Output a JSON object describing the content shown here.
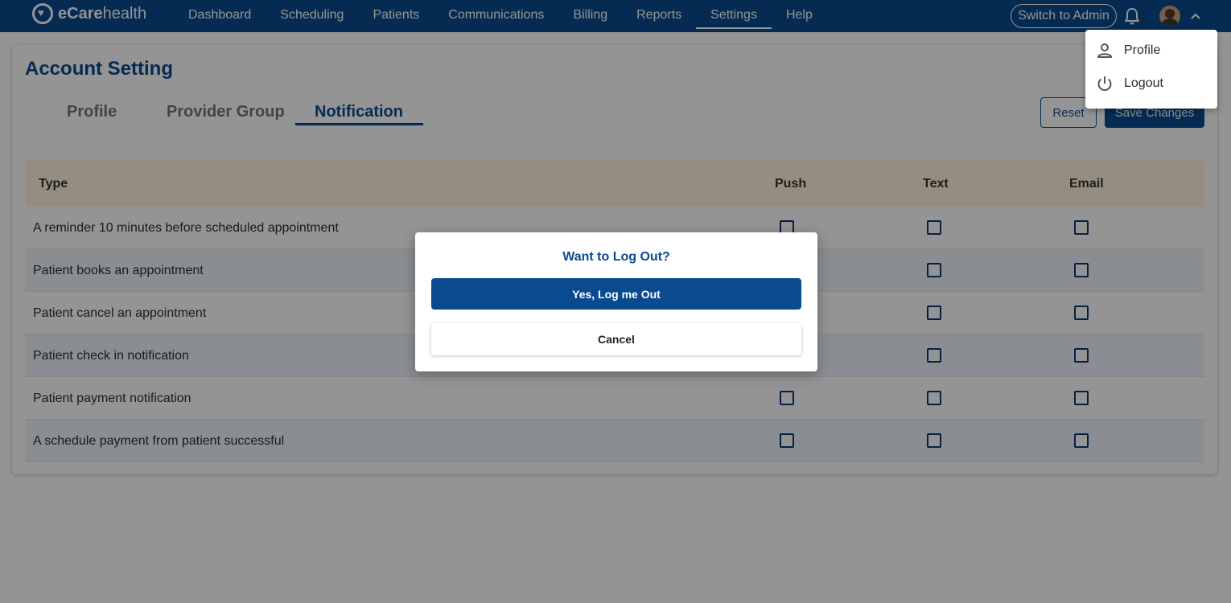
{
  "brand": {
    "name_bold": "eCare",
    "name_rest": "health"
  },
  "nav": {
    "items": [
      {
        "label": "Dashboard"
      },
      {
        "label": "Scheduling"
      },
      {
        "label": "Patients"
      },
      {
        "label": "Communications"
      },
      {
        "label": "Billing"
      },
      {
        "label": "Reports"
      },
      {
        "label": "Settings",
        "active": true
      },
      {
        "label": "Help"
      }
    ],
    "switch_label": "Switch to Admin",
    "bell_icon": "bell-icon",
    "avatar": "user-avatar",
    "chevron_icon": "chevron-up-icon"
  },
  "page": {
    "title": "Account Setting",
    "tabs": [
      {
        "label": "Profile"
      },
      {
        "label": "Provider Group"
      },
      {
        "label": "Notification",
        "active": true
      }
    ],
    "reset_label": "Reset",
    "save_label": "Save Changes"
  },
  "table": {
    "headers": {
      "type": "Type",
      "push": "Push",
      "text": "Text",
      "email": "Email"
    },
    "rows": [
      {
        "label": "A reminder 10 minutes before scheduled appointment"
      },
      {
        "label": "Patient books an appointment"
      },
      {
        "label": "Patient cancel an appointment"
      },
      {
        "label": "Patient check in notification"
      },
      {
        "label": "Patient payment notification"
      },
      {
        "label": "A schedule payment from patient successful"
      }
    ]
  },
  "menu": {
    "items": [
      {
        "label": "Profile",
        "icon": "person-icon"
      },
      {
        "label": "Logout",
        "icon": "power-icon"
      }
    ]
  },
  "modal": {
    "title": "Want to Log Out?",
    "confirm_label": "Yes, Log me Out",
    "cancel_label": "Cancel"
  },
  "colors": {
    "primary": "#0a4a90",
    "header_bg": "#fff3dc",
    "row_alt": "#eef5fb"
  }
}
